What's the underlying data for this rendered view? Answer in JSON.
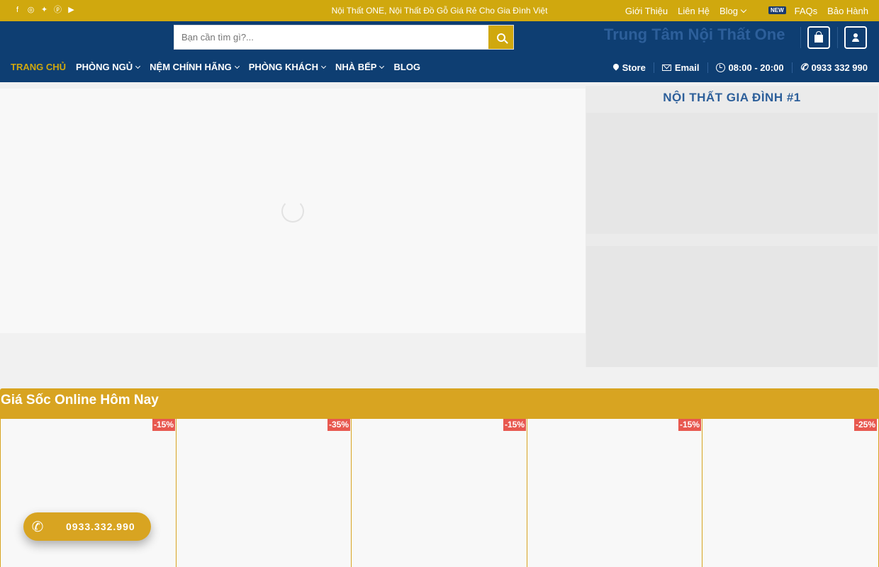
{
  "topbar": {
    "social_icons": [
      "facebook-icon",
      "instagram-icon",
      "twitter-icon",
      "pinterest-icon",
      "youtube-icon"
    ],
    "tagline": "Nội Thất ONE, Nội Thất Đồ Gỗ Giá Rẻ Cho Gia Đình Việt",
    "links": {
      "about": "Giới Thiệu",
      "contact": "Liên Hệ",
      "blog": "Blog",
      "blog_badge": "NEW",
      "faqs": "FAQs",
      "warranty": "Bảo Hành"
    }
  },
  "header": {
    "search_placeholder": "Bạn cần tìm gì?...",
    "brand": "Trung Tâm Nội Thất One"
  },
  "nav": {
    "items": [
      {
        "label": "TRANG CHỦ",
        "active": true,
        "dropdown": false
      },
      {
        "label": "PHÒNG NGỦ",
        "active": false,
        "dropdown": true
      },
      {
        "label": "NỆM CHÍNH HÃNG",
        "active": false,
        "dropdown": true
      },
      {
        "label": "PHÒNG KHÁCH",
        "active": false,
        "dropdown": true
      },
      {
        "label": "NHÀ BẾP",
        "active": false,
        "dropdown": true
      },
      {
        "label": "BLOG",
        "active": false,
        "dropdown": false
      }
    ],
    "right": {
      "store": "Store",
      "email": "Email",
      "hours": "08:00 - 20:00",
      "phone": "0933 332 990"
    }
  },
  "sidebar": {
    "title": "NỘI THẤT GIA ĐÌNH #1"
  },
  "deals": {
    "title": "Giá Sốc Online Hôm Nay",
    "products": [
      {
        "discount": "-15%"
      },
      {
        "discount": "-35%"
      },
      {
        "discount": "-15%"
      },
      {
        "discount": "-15%"
      },
      {
        "discount": "-25%"
      }
    ]
  },
  "float_call": {
    "number": "0933.332.990"
  },
  "colors": {
    "gold": "#d0a80e",
    "navy": "#0e3e72",
    "brand_blue": "#2d5f9a",
    "sale_red": "#e8584f"
  }
}
